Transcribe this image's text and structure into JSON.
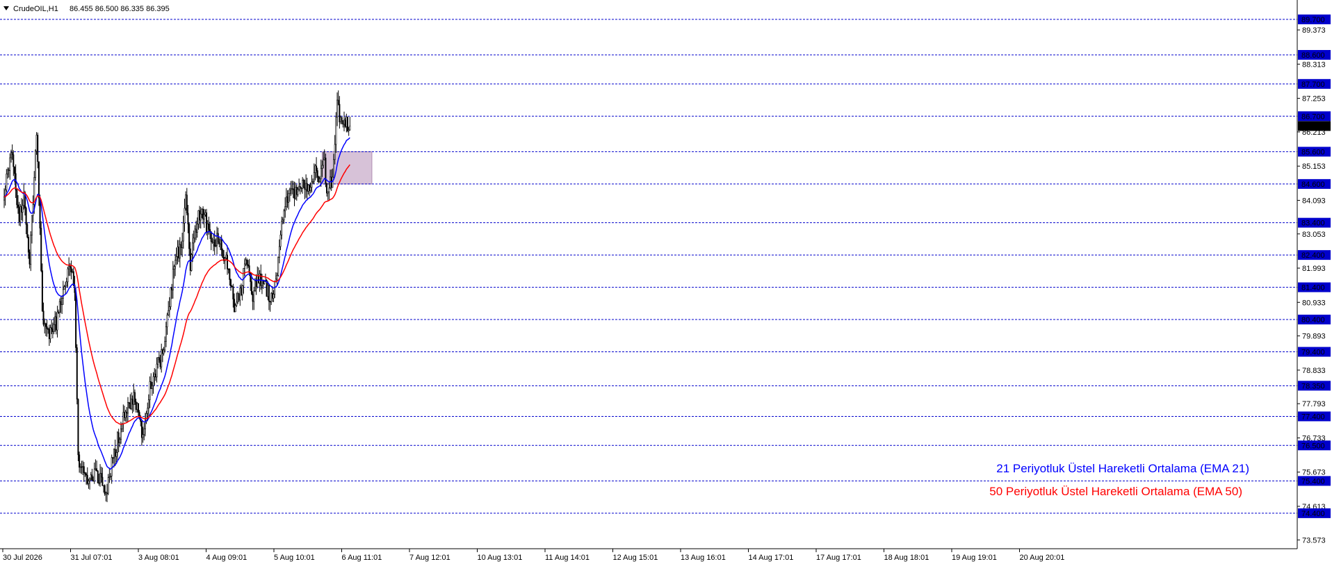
{
  "header": {
    "symbol": "CrudeOIL,H1",
    "ohlc": "86.455 86.500 86.335 86.395",
    "menu_icon": "triangle-down-icon"
  },
  "colors": {
    "background": "#ffffff",
    "level_line": "#0000cc",
    "level_tag_bg": "#0000cc",
    "ema21": "#0000ff",
    "ema50": "#ff0000",
    "candle_up": "#000000",
    "candle_down": "#000000",
    "zone_fill": "#c9aecb",
    "price_tag_bg": "#000000"
  },
  "chart_data": {
    "type": "candlestick",
    "timeframe": "H1",
    "ylim": [
      73.3,
      90.3
    ],
    "grid": false,
    "y_ticks": [
      "89.373",
      "88.313",
      "87.253",
      "86.213",
      "85.153",
      "84.093",
      "83.053",
      "81.993",
      "80.933",
      "79.893",
      "78.833",
      "77.793",
      "76.733",
      "75.673",
      "74.613",
      "73.573"
    ],
    "y_tick_values": [
      89.373,
      88.313,
      87.253,
      86.213,
      85.153,
      84.093,
      83.053,
      81.993,
      80.933,
      79.893,
      78.833,
      77.793,
      76.733,
      75.673,
      74.613,
      73.573
    ],
    "level_tags": [
      "89.700",
      "88.600",
      "87.700",
      "86.700",
      "85.600",
      "84.600",
      "83.400",
      "82.400",
      "81.400",
      "80.400",
      "79.400",
      "78.350",
      "77.400",
      "76.500",
      "75.400",
      "74.400"
    ],
    "level_values": [
      89.7,
      88.6,
      87.7,
      86.7,
      85.6,
      84.6,
      83.4,
      82.4,
      81.4,
      80.4,
      79.4,
      78.35,
      77.4,
      76.5,
      75.4,
      74.4
    ],
    "current_price": "86.395",
    "current_price_value": 86.395,
    "x_labels": [
      "30 Jul 2026",
      "31 Jul 07:01",
      "3 Aug 08:01",
      "4 Aug 09:01",
      "5 Aug 10:01",
      "6 Aug 11:01",
      "7 Aug 12:01",
      "10 Aug 13:01",
      "11 Aug 14:01",
      "12 Aug 15:01",
      "13 Aug 16:01",
      "14 Aug 17:01",
      "17 Aug 17:01",
      "18 Aug 18:01",
      "19 Aug 19:01",
      "20 Aug 20:01"
    ],
    "zone": {
      "low": 84.6,
      "high": 85.6,
      "from_bar": 275,
      "to_bar": 318
    },
    "bar_count": 300,
    "anchors": [
      [
        0,
        84.2
      ],
      [
        6,
        85.7
      ],
      [
        13,
        83.6
      ],
      [
        17,
        84.1
      ],
      [
        22,
        82.2
      ],
      [
        26,
        84.6
      ],
      [
        28,
        86.3
      ],
      [
        30,
        84.3
      ],
      [
        33,
        80.6
      ],
      [
        38,
        79.9
      ],
      [
        45,
        80.3
      ],
      [
        52,
        81.4
      ],
      [
        58,
        82.1
      ],
      [
        61,
        81.0
      ],
      [
        64,
        76.1
      ],
      [
        72,
        75.4
      ],
      [
        80,
        75.6
      ],
      [
        88,
        75.1
      ],
      [
        96,
        76.4
      ],
      [
        104,
        77.4
      ],
      [
        112,
        78.1
      ],
      [
        120,
        76.8
      ],
      [
        126,
        78.4
      ],
      [
        132,
        78.9
      ],
      [
        138,
        79.4
      ],
      [
        144,
        81.3
      ],
      [
        148,
        82.3
      ],
      [
        153,
        82.6
      ],
      [
        157,
        84.4
      ],
      [
        161,
        82.1
      ],
      [
        166,
        83.3
      ],
      [
        171,
        83.9
      ],
      [
        176,
        83.2
      ],
      [
        181,
        82.8
      ],
      [
        186,
        82.9
      ],
      [
        191,
        82.3
      ],
      [
        196,
        81.6
      ],
      [
        199,
        80.6
      ],
      [
        205,
        81.4
      ],
      [
        210,
        82.3
      ],
      [
        215,
        81.2
      ],
      [
        220,
        81.7
      ],
      [
        225,
        81.5
      ],
      [
        230,
        81.1
      ],
      [
        236,
        81.7
      ],
      [
        240,
        83.6
      ],
      [
        246,
        84.2
      ],
      [
        252,
        84.4
      ],
      [
        258,
        84.5
      ],
      [
        264,
        84.6
      ],
      [
        270,
        85.0
      ],
      [
        272,
        84.6
      ],
      [
        276,
        85.5
      ],
      [
        279,
        84.5
      ],
      [
        284,
        84.8
      ],
      [
        286,
        85.9
      ],
      [
        288,
        87.0
      ],
      [
        291,
        86.5
      ],
      [
        295,
        86.6
      ],
      [
        298,
        86.3
      ],
      [
        299,
        86.395
      ]
    ]
  },
  "legend": {
    "ema21": "21 Periyotluk Üstel Hareketli Ortalama (EMA 21)",
    "ema50": "50 Periyotluk Üstel Hareketli Ortalama (EMA 50)"
  }
}
